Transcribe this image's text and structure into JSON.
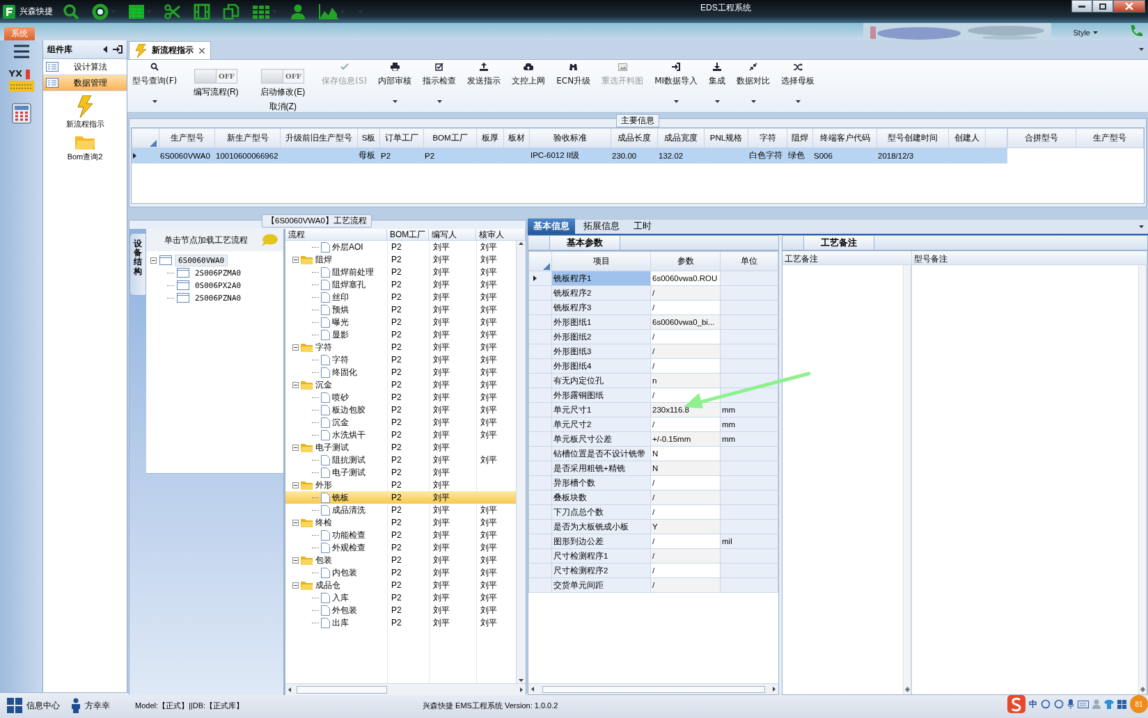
{
  "window": {
    "title": "EDS工程系统",
    "app_name": "兴森快捷"
  },
  "ribbon_tabs": [
    {
      "label": "系统",
      "selected": true
    }
  ],
  "style_menu": {
    "label": "Style"
  },
  "icon_bar": {
    "logo_text": "YX"
  },
  "sidebar": {
    "title": "组件库",
    "items": [
      {
        "label": "设计算法",
        "selected": false
      },
      {
        "label": "数据管理",
        "selected": true
      }
    ],
    "launchers": [
      {
        "label": "新流程指示"
      },
      {
        "label": "Bom查询2"
      }
    ]
  },
  "doc_tabs": [
    {
      "label": "新流程指示",
      "selected": true
    }
  ],
  "toolbar": [
    {
      "kind": "button",
      "label": "型号查询(F)",
      "disabled": false,
      "dropdown": true
    },
    {
      "kind": "toggle",
      "label": "编写流程(R)",
      "on": false,
      "switch_text": "OFF"
    },
    {
      "kind": "toggle",
      "label": "启动修改(E)",
      "label2": "取消(Z)",
      "on": false,
      "switch_text": "OFF"
    },
    {
      "kind": "button",
      "label": "保存信息(S)",
      "disabled": true,
      "dropdown": false
    },
    {
      "kind": "button",
      "label": "内部审核",
      "disabled": false,
      "dropdown": true
    },
    {
      "kind": "button",
      "label": "指示检查",
      "disabled": false,
      "dropdown": true
    },
    {
      "kind": "button",
      "label": "发送指示",
      "disabled": false,
      "dropdown": false
    },
    {
      "kind": "button",
      "label": "文控上网",
      "disabled": false,
      "dropdown": false
    },
    {
      "kind": "button",
      "label": "ECN升级",
      "disabled": false,
      "dropdown": false
    },
    {
      "kind": "button",
      "label": "重选开料图",
      "disabled": true,
      "dropdown": false
    },
    {
      "kind": "button",
      "label": "MI数据导入",
      "disabled": false,
      "dropdown": true
    },
    {
      "kind": "button",
      "label": "集成",
      "disabled": false,
      "dropdown": true
    },
    {
      "kind": "button",
      "label": "数据对比",
      "disabled": false,
      "dropdown": true
    },
    {
      "kind": "button",
      "label": "选择母板",
      "disabled": false,
      "dropdown": true
    }
  ],
  "main_info": {
    "title": "主要信息",
    "table": {
      "columns": [
        "生产型号",
        "新生产型号",
        "升级前旧生产型号",
        "S板",
        "订单工厂",
        "BOM工厂",
        "板厚",
        "板材",
        "验收标准",
        "成品长度",
        "成品宽度",
        "PNL规格",
        "字符",
        "阻焊",
        "终端客户代码",
        "型号创建时间",
        "创建人"
      ],
      "rows": [
        {
          "selected": true,
          "cells": [
            "6S0060VWA0",
            "10010600066962",
            null,
            "母板",
            "P2",
            "P2",
            null,
            null,
            "IPC-6012 II级",
            "230.00",
            "132.02",
            null,
            "白色字符",
            "绿色",
            "S006",
            "2018/12/3",
            null
          ]
        }
      ]
    },
    "merge_table": {
      "columns": [
        "合拼型号",
        "生产型号"
      ]
    }
  },
  "process": {
    "title": "【6S0060VWA0】工艺流程",
    "side_tab": "设备结构",
    "hint": "单击节点加载工艺流程",
    "tree": [
      {
        "label": "6S0060VWA0",
        "expanded": true,
        "selected": true,
        "children": [
          {
            "label": "2S006PZMA0",
            "selected": false
          },
          {
            "label": "0S006PX2A0",
            "selected": false
          },
          {
            "label": "2S006PZNA0",
            "selected": false
          }
        ]
      }
    ],
    "flow": {
      "columns": [
        "流程",
        "BOM工厂",
        "编写人",
        "核审人"
      ],
      "rows": [
        {
          "name": "外层AOI",
          "bom": "P2",
          "writer": "刘平",
          "reviewer": "刘平",
          "selected": false
        },
        {
          "name": "阻焊",
          "bom": "P2",
          "writer": "刘平",
          "reviewer": "刘平",
          "selected": false,
          "expanded": true,
          "children": [
            {
              "name": "阻焊前处理",
              "bom": "P2",
              "writer": "刘平",
              "reviewer": "刘平",
              "selected": false
            },
            {
              "name": "阻焊塞孔",
              "bom": "P2",
              "writer": "刘平",
              "reviewer": "刘平",
              "selected": false
            },
            {
              "name": "丝印",
              "bom": "P2",
              "writer": "刘平",
              "reviewer": "刘平",
              "selected": false
            },
            {
              "name": "预烘",
              "bom": "P2",
              "writer": "刘平",
              "reviewer": "刘平",
              "selected": false
            },
            {
              "name": "曝光",
              "bom": "P2",
              "writer": "刘平",
              "reviewer": "刘平",
              "selected": false
            },
            {
              "name": "显影",
              "bom": "P2",
              "writer": "刘平",
              "reviewer": "刘平",
              "selected": false
            }
          ]
        },
        {
          "name": "字符",
          "bom": "P2",
          "writer": "刘平",
          "reviewer": "刘平",
          "selected": false,
          "expanded": true,
          "children": [
            {
              "name": "字符",
              "bom": "P2",
              "writer": "刘平",
              "reviewer": "刘平",
              "selected": false
            },
            {
              "name": "终固化",
              "bom": "P2",
              "writer": "刘平",
              "reviewer": "刘平",
              "selected": false
            }
          ]
        },
        {
          "name": "沉金",
          "bom": "P2",
          "writer": "刘平",
          "reviewer": "刘平",
          "selected": false,
          "expanded": true,
          "children": [
            {
              "name": "喷砂",
              "bom": "P2",
              "writer": "刘平",
              "reviewer": "刘平",
              "selected": false
            },
            {
              "name": "板边包胶",
              "bom": "P2",
              "writer": "刘平",
              "reviewer": "刘平",
              "selected": false
            },
            {
              "name": "沉金",
              "bom": "P2",
              "writer": "刘平",
              "reviewer": "刘平",
              "selected": false
            },
            {
              "name": "水洗烘干",
              "bom": "P2",
              "writer": "刘平",
              "reviewer": "刘平",
              "selected": false
            }
          ]
        },
        {
          "name": "电子测试",
          "bom": "P2",
          "writer": "刘平",
          "selected": false,
          "expanded": true,
          "children": [
            {
              "name": "阻抗测试",
              "bom": "P2",
              "writer": "刘平",
              "reviewer": "刘平",
              "selected": false
            },
            {
              "name": "电子测试",
              "bom": "P2",
              "writer": "刘平",
              "selected": false
            }
          ]
        },
        {
          "name": "外形",
          "bom": "P2",
          "writer": "刘平",
          "selected": false,
          "expanded": true,
          "children": [
            {
              "name": "铣板",
              "bom": "P2",
              "writer": "刘平",
              "selected": true
            },
            {
              "name": "成品清洗",
              "bom": "P2",
              "writer": "刘平",
              "reviewer": "刘平",
              "selected": false
            }
          ]
        },
        {
          "name": "终检",
          "bom": "P2",
          "writer": "刘平",
          "reviewer": "刘平",
          "selected": false,
          "expanded": true,
          "children": [
            {
              "name": "功能检查",
              "bom": "P2",
              "writer": "刘平",
              "reviewer": "刘平",
              "selected": false
            },
            {
              "name": "外观检查",
              "bom": "P2",
              "writer": "刘平",
              "reviewer": "刘平",
              "selected": false
            }
          ]
        },
        {
          "name": "包装",
          "bom": "P2",
          "writer": "刘平",
          "reviewer": "刘平",
          "selected": false,
          "expanded": true,
          "children": [
            {
              "name": "内包装",
              "bom": "P2",
              "writer": "刘平",
              "reviewer": "刘平",
              "selected": false
            }
          ]
        },
        {
          "name": "成品仓",
          "bom": "P2",
          "writer": "刘平",
          "reviewer": "刘平",
          "selected": false,
          "expanded": true,
          "children": [
            {
              "name": "入库",
              "bom": "P2",
              "writer": "刘平",
              "reviewer": "刘平",
              "selected": false
            },
            {
              "name": "外包装",
              "bom": "P2",
              "writer": "刘平",
              "reviewer": "刘平",
              "selected": false
            },
            {
              "name": "出库",
              "bom": "P2",
              "writer": "刘平",
              "reviewer": "刘平",
              "selected": false
            }
          ]
        }
      ]
    }
  },
  "details": {
    "tabs": [
      {
        "label": "基本信息",
        "selected": true
      },
      {
        "label": "拓展信息",
        "selected": false
      },
      {
        "label": "工时",
        "selected": false
      }
    ],
    "basic": {
      "title": "基本参数",
      "columns": [
        "项目",
        "参数",
        "单位"
      ],
      "rows": [
        {
          "item": "铣板程序1",
          "value": "6s0060vwa0.ROU",
          "selected": true
        },
        {
          "item": "铣板程序2",
          "value": "/",
          "selected": false
        },
        {
          "item": "铣板程序3",
          "value": "/",
          "selected": false
        },
        {
          "item": "外形图纸1",
          "value": "6s0060vwa0_bi...",
          "selected": false
        },
        {
          "item": "外形图纸2",
          "value": "/",
          "selected": false
        },
        {
          "item": "外形图纸3",
          "value": "/",
          "selected": false
        },
        {
          "item": "外形图纸4",
          "value": "/",
          "selected": false
        },
        {
          "item": "有无内定位孔",
          "value": "n",
          "selected": false
        },
        {
          "item": "外形露铜图纸",
          "value": "/",
          "selected": false
        },
        {
          "item": "单元尺寸1",
          "value": "230x116.8",
          "unit": "mm",
          "selected": false
        },
        {
          "item": "单元尺寸2",
          "value": "/",
          "unit": "mm",
          "selected": false
        },
        {
          "item": "单元板尺寸公差",
          "value": "+/-0.15mm",
          "unit": "mm",
          "selected": false
        },
        {
          "item": "钻槽位置是否不设计铣带",
          "value": "N",
          "selected": false
        },
        {
          "item": "是否采用粗铣+精铣",
          "value": "N",
          "selected": false
        },
        {
          "item": "异形槽个数",
          "value": "/",
          "selected": false
        },
        {
          "item": "叠板块数",
          "value": "/",
          "selected": false
        },
        {
          "item": "下刀点总个数",
          "value": "/",
          "selected": false
        },
        {
          "item": "是否为大板铣成小板",
          "value": "Y",
          "selected": false
        },
        {
          "item": "图形到边公差",
          "value": "/",
          "unit": "mil",
          "selected": false
        },
        {
          "item": "尺寸检测程序1",
          "value": "/",
          "selected": false
        },
        {
          "item": "尺寸检测程序2",
          "value": "/",
          "selected": false
        },
        {
          "item": "交货单元间距",
          "value": "/",
          "selected": false
        }
      ]
    },
    "remarks": {
      "title": "工艺备注",
      "columns": [
        "工艺备注",
        "型号备注"
      ]
    }
  },
  "status_bar": {
    "info_center": "信息中心",
    "user": "方幸幸",
    "model": "Model:【正式】||DB:【正式库】",
    "product": "兴森快捷 EMS工程系统 Version: 1.0.0.2",
    "ime": "中",
    "badge": "81"
  }
}
